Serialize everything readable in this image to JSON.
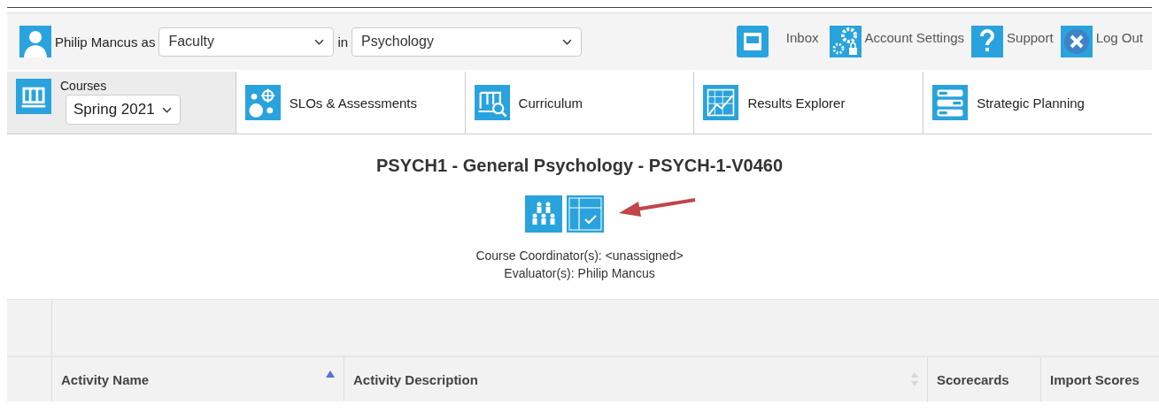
{
  "header": {
    "user": "Philip Mancus as",
    "role": {
      "value": "Faculty"
    },
    "in_label": "in",
    "department": {
      "value": "Psychology"
    },
    "links": [
      {
        "kind": "inbox",
        "label": "Inbox"
      },
      {
        "kind": "settings",
        "label": "Account Settings"
      },
      {
        "kind": "support",
        "label": "Support"
      },
      {
        "kind": "logout",
        "label": "Log Out"
      }
    ]
  },
  "tabs": [
    {
      "kind": "courses",
      "label": "Courses",
      "term": "Spring 2021",
      "selected": true
    },
    {
      "kind": "slos",
      "label": "SLOs & Assessments",
      "selected": false
    },
    {
      "kind": "curriculum",
      "label": "Curriculum",
      "selected": false
    },
    {
      "kind": "results",
      "label": "Results Explorer",
      "selected": false
    },
    {
      "kind": "planning",
      "label": "Strategic Planning",
      "selected": false
    }
  ],
  "course": {
    "title": "PSYCH1 - General Psychology - PSYCH-1-V0460",
    "coordinator": "Course Coordinator(s): <unassigned>",
    "evaluator": "Evaluator(s): Philip Mancus"
  },
  "table": {
    "columns": [
      {
        "label": "Activity Name",
        "sorted": true
      },
      {
        "label": "Activity Description",
        "sorted": false
      },
      {
        "label": "Scorecards"
      },
      {
        "label": "Import Scores"
      }
    ]
  }
}
